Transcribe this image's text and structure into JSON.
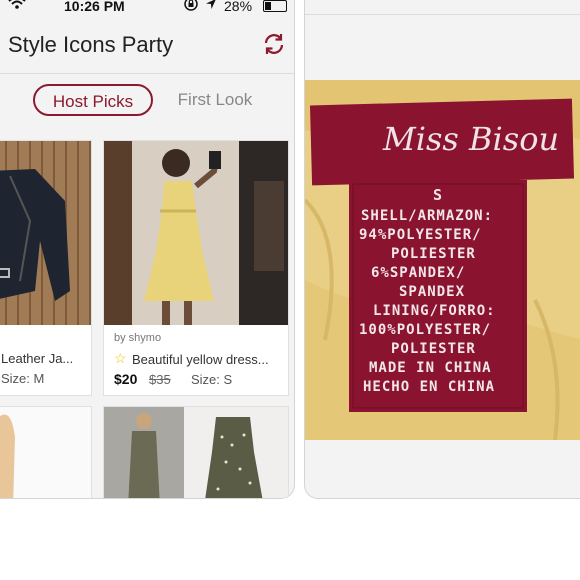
{
  "status": {
    "time": "10:26 PM",
    "battery": "28%",
    "battery_level": 0.28
  },
  "header": {
    "title": "Style Icons Party"
  },
  "tabs": [
    {
      "label": "Host Picks",
      "active": true
    },
    {
      "label": "First Look",
      "active": false
    }
  ],
  "listings": [
    {
      "name": "Leather Ja...",
      "size": "Size: M"
    },
    {
      "seller": "by shymo",
      "name": "Beautiful yellow dress...",
      "price": "$20",
      "original_price": "$35",
      "size": "Size: S"
    }
  ],
  "label_photo": {
    "brand": "Miss Bisou",
    "lines": [
      "S",
      "SHELL/ARMAZON:",
      "94%POLYESTER/",
      "POLIESTER",
      "6%SPANDEX/",
      "SPANDEX",
      "LINING/FORRO:",
      "100%POLYESTER/",
      "POLIESTER",
      "MADE IN CHINA",
      "HECHO EN CHINA"
    ]
  },
  "colors": {
    "accent": "#8b1a2e",
    "label": "#8a1330",
    "fabric": "#e9cf86"
  }
}
